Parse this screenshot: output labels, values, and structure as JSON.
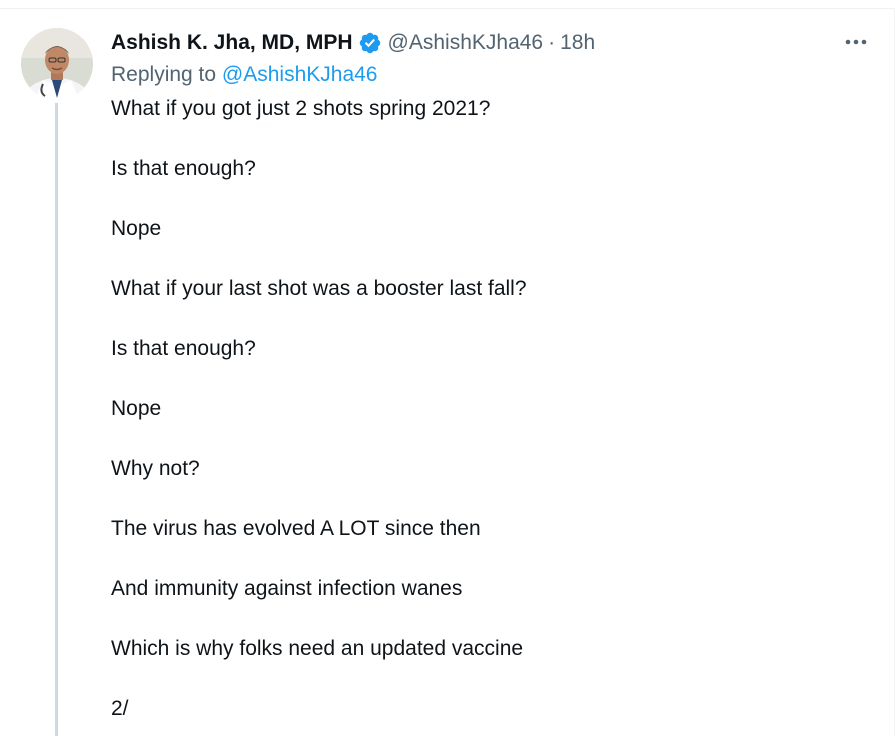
{
  "tweet": {
    "author": {
      "display_name": "Ashish K. Jha, MD, MPH",
      "handle": "@AshishKJha46",
      "verified": true,
      "avatar_icon": "profile-photo"
    },
    "separator": "·",
    "time": "18h",
    "replying_label": "Replying to",
    "replying_to": "@AshishKJha46",
    "lines": [
      "What if you got just 2 shots spring 2021?",
      "Is that enough?",
      "Nope",
      "What if your last shot was a booster last fall?",
      "Is that enough?",
      "Nope",
      "Why not?",
      "The virus has evolved A LOT since then",
      "And immunity against infection wanes",
      "Which is why folks need an updated vaccine",
      "2/"
    ],
    "more_icon": "more-horizontal-icon"
  },
  "colors": {
    "text": "#0f1419",
    "secondary": "#536471",
    "accent": "#1d9bf0",
    "thread_line": "#cfd9de"
  }
}
